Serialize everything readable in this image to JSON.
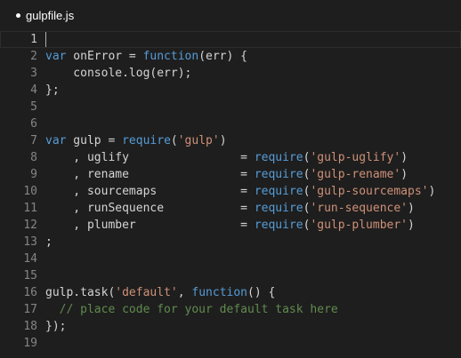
{
  "tab": {
    "title": "gulpfile.js"
  },
  "colors": {
    "background": "#1e1e1e",
    "keyword": "#569cd6",
    "string": "#ce9178",
    "comment": "#608b4e",
    "plain": "#d4d4d4",
    "line_number": "#858585"
  },
  "lines": [
    {
      "num": "1",
      "tokens": []
    },
    {
      "num": "2",
      "tokens": [
        {
          "t": "kw",
          "v": "var"
        },
        {
          "t": "pl",
          "v": " onError = "
        },
        {
          "t": "kw",
          "v": "function"
        },
        {
          "t": "pl",
          "v": "(err) {"
        }
      ]
    },
    {
      "num": "3",
      "tokens": [
        {
          "t": "pl",
          "v": "    console.log(err);"
        }
      ]
    },
    {
      "num": "4",
      "tokens": [
        {
          "t": "pl",
          "v": "};"
        }
      ]
    },
    {
      "num": "5",
      "tokens": []
    },
    {
      "num": "6",
      "tokens": []
    },
    {
      "num": "7",
      "tokens": [
        {
          "t": "kw",
          "v": "var"
        },
        {
          "t": "pl",
          "v": " gulp = "
        },
        {
          "t": "kw",
          "v": "require"
        },
        {
          "t": "pl",
          "v": "("
        },
        {
          "t": "str",
          "v": "'gulp'"
        },
        {
          "t": "pl",
          "v": ")"
        }
      ]
    },
    {
      "num": "8",
      "tokens": [
        {
          "t": "pl",
          "v": "    , uglify                = "
        },
        {
          "t": "kw",
          "v": "require"
        },
        {
          "t": "pl",
          "v": "("
        },
        {
          "t": "str",
          "v": "'gulp-uglify'"
        },
        {
          "t": "pl",
          "v": ")"
        }
      ]
    },
    {
      "num": "9",
      "tokens": [
        {
          "t": "pl",
          "v": "    , rename                = "
        },
        {
          "t": "kw",
          "v": "require"
        },
        {
          "t": "pl",
          "v": "("
        },
        {
          "t": "str",
          "v": "'gulp-rename'"
        },
        {
          "t": "pl",
          "v": ")"
        }
      ]
    },
    {
      "num": "10",
      "tokens": [
        {
          "t": "pl",
          "v": "    , sourcemaps            = "
        },
        {
          "t": "kw",
          "v": "require"
        },
        {
          "t": "pl",
          "v": "("
        },
        {
          "t": "str",
          "v": "'gulp-sourcemaps'"
        },
        {
          "t": "pl",
          "v": ")"
        }
      ]
    },
    {
      "num": "11",
      "tokens": [
        {
          "t": "pl",
          "v": "    , runSequence           = "
        },
        {
          "t": "kw",
          "v": "require"
        },
        {
          "t": "pl",
          "v": "("
        },
        {
          "t": "str",
          "v": "'run-sequence'"
        },
        {
          "t": "pl",
          "v": ")"
        }
      ]
    },
    {
      "num": "12",
      "tokens": [
        {
          "t": "pl",
          "v": "    , plumber               = "
        },
        {
          "t": "kw",
          "v": "require"
        },
        {
          "t": "pl",
          "v": "("
        },
        {
          "t": "str",
          "v": "'gulp-plumber'"
        },
        {
          "t": "pl",
          "v": ")"
        }
      ]
    },
    {
      "num": "13",
      "tokens": [
        {
          "t": "pl",
          "v": ";"
        }
      ]
    },
    {
      "num": "14",
      "tokens": []
    },
    {
      "num": "15",
      "tokens": []
    },
    {
      "num": "16",
      "tokens": [
        {
          "t": "pl",
          "v": "gulp.task("
        },
        {
          "t": "str",
          "v": "'default'"
        },
        {
          "t": "pl",
          "v": ", "
        },
        {
          "t": "kw",
          "v": "function"
        },
        {
          "t": "pl",
          "v": "() {"
        }
      ]
    },
    {
      "num": "17",
      "tokens": [
        {
          "t": "cm",
          "v": "  // place code for your default task here"
        }
      ]
    },
    {
      "num": "18",
      "tokens": [
        {
          "t": "pl",
          "v": "});"
        }
      ]
    },
    {
      "num": "19",
      "tokens": []
    }
  ]
}
